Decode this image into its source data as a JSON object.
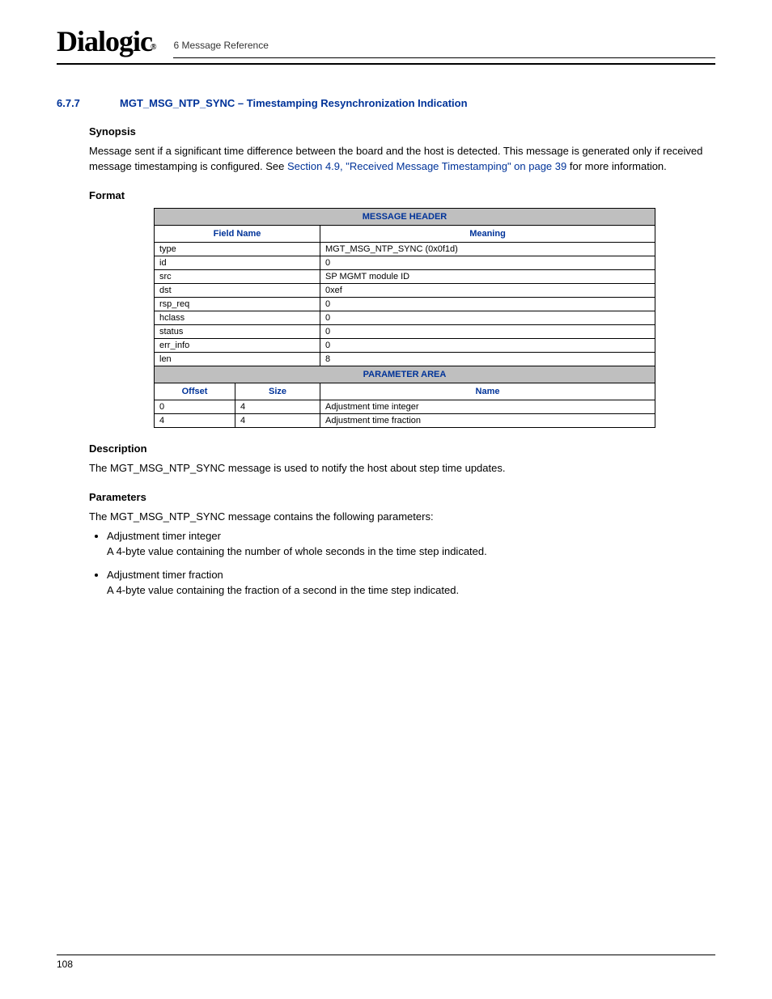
{
  "header": {
    "logo": "Dialogic",
    "logo_reg": "®",
    "breadcrumb": "6 Message Reference"
  },
  "section": {
    "number": "6.7.7",
    "title": "MGT_MSG_NTP_SYNC – Timestamping Resynchronization Indication"
  },
  "synopsis": {
    "heading": "Synopsis",
    "text_before_link": "Message sent if a significant time difference between the board and the host is detected. This message is generated only if received message timestamping is configured. See ",
    "link_text": "Section 4.9, \"Received Message Timestamping\" on page 39",
    "text_after_link": " for more information."
  },
  "format": {
    "heading": "Format",
    "table": {
      "header1": "MESSAGE HEADER",
      "col_field": "Field Name",
      "col_meaning": "Meaning",
      "rows": [
        {
          "field": "type",
          "meaning": "MGT_MSG_NTP_SYNC (0x0f1d)"
        },
        {
          "field": "id",
          "meaning": "0"
        },
        {
          "field": "src",
          "meaning": "SP MGMT module ID"
        },
        {
          "field": "dst",
          "meaning": "0xef"
        },
        {
          "field": "rsp_req",
          "meaning": "0"
        },
        {
          "field": "hclass",
          "meaning": "0"
        },
        {
          "field": "status",
          "meaning": "0"
        },
        {
          "field": "err_info",
          "meaning": "0"
        },
        {
          "field": "len",
          "meaning": "8"
        }
      ],
      "header2": "PARAMETER AREA",
      "col_offset": "Offset",
      "col_size": "Size",
      "col_name": "Name",
      "param_rows": [
        {
          "offset": "0",
          "size": "4",
          "name": "Adjustment time integer"
        },
        {
          "offset": "4",
          "size": "4",
          "name": "Adjustment time fraction"
        }
      ]
    }
  },
  "description": {
    "heading": "Description",
    "text": "The MGT_MSG_NTP_SYNC message is used to notify the host about step time updates."
  },
  "parameters": {
    "heading": "Parameters",
    "intro": "The MGT_MSG_NTP_SYNC message contains the following parameters:",
    "items": [
      {
        "name": "Adjustment timer integer",
        "desc": "A 4-byte value containing the number of whole seconds in the time step indicated."
      },
      {
        "name": "Adjustment timer fraction",
        "desc": "A 4-byte value containing the fraction of a second in the time step indicated."
      }
    ]
  },
  "footer": {
    "page_number": "108"
  }
}
